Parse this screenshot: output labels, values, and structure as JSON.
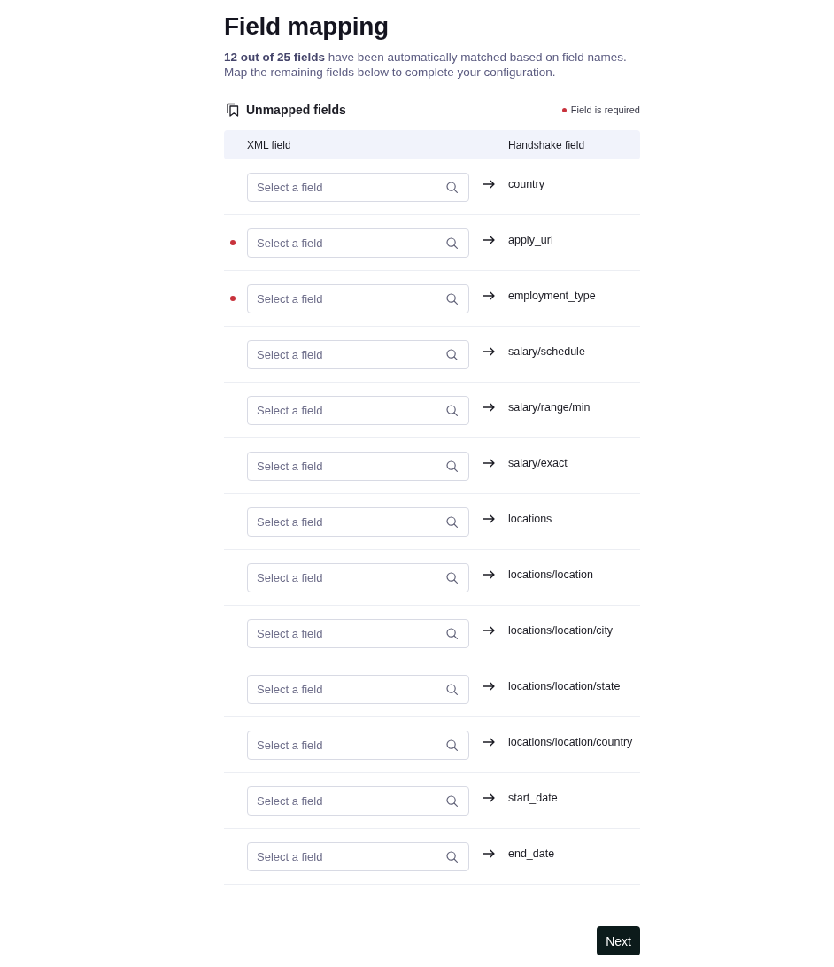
{
  "page": {
    "title": "Field mapping",
    "intro": "**12 out of 25 fields** have been automatically matched based on field names. Map the remaining fields below to complete your configuration."
  },
  "section": {
    "title": "Unmapped fields",
    "legend": "Field is required"
  },
  "table": {
    "columns": [
      "XML field",
      "Handshake field"
    ],
    "rows": [
      {
        "required": false,
        "placeholder": "Select a field",
        "target": "country"
      },
      {
        "required": true,
        "placeholder": "Select a field",
        "target": "apply_url"
      },
      {
        "required": true,
        "placeholder": "Select a field",
        "target": "employment_type"
      },
      {
        "required": false,
        "placeholder": "Select a field",
        "target": "salary/schedule"
      },
      {
        "required": false,
        "placeholder": "Select a field",
        "target": "salary/range/min"
      },
      {
        "required": false,
        "placeholder": "Select a field",
        "target": "salary/exact"
      },
      {
        "required": false,
        "placeholder": "Select a field",
        "target": "locations"
      },
      {
        "required": false,
        "placeholder": "Select a field",
        "target": "locations/location"
      },
      {
        "required": false,
        "placeholder": "Select a field",
        "target": "locations/location/city"
      },
      {
        "required": false,
        "placeholder": "Select a field",
        "target": "locations/location/state"
      },
      {
        "required": false,
        "placeholder": "Select a field",
        "target": "locations/location/country"
      },
      {
        "required": false,
        "placeholder": "Select a field",
        "target": "start_date"
      },
      {
        "required": false,
        "placeholder": "Select a field",
        "target": "end_date"
      }
    ]
  },
  "buttons": [
    {
      "label": "Next"
    }
  ]
}
